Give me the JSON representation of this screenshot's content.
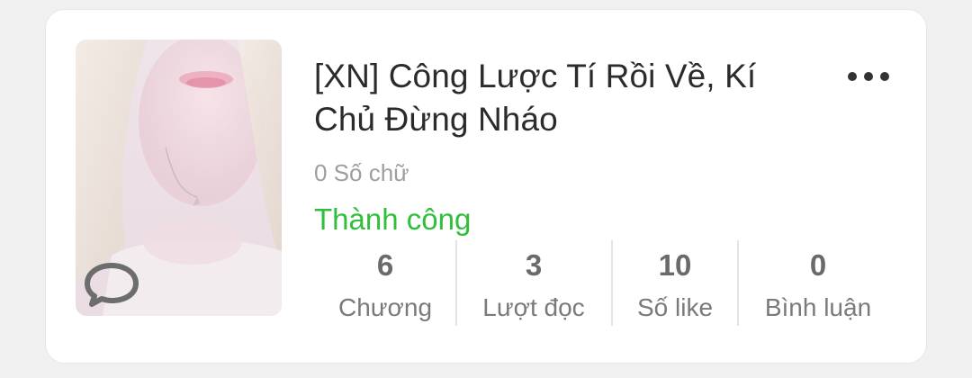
{
  "book": {
    "title": "[XN] Công Lược Tí Rồi Về, Kí Chủ Đừng Nháo",
    "word_count": "0 Số chữ",
    "status": "Thành công",
    "status_color": "#2fbf3a",
    "more_icon": "more-horizontal-icon",
    "cover_badge_icon": "comment-bubble-icon"
  },
  "stats": [
    {
      "value": "6",
      "label": "Chương"
    },
    {
      "value": "3",
      "label": "Lượt đọc"
    },
    {
      "value": "10",
      "label": "Số like"
    },
    {
      "value": "0",
      "label": "Bình luận"
    }
  ]
}
